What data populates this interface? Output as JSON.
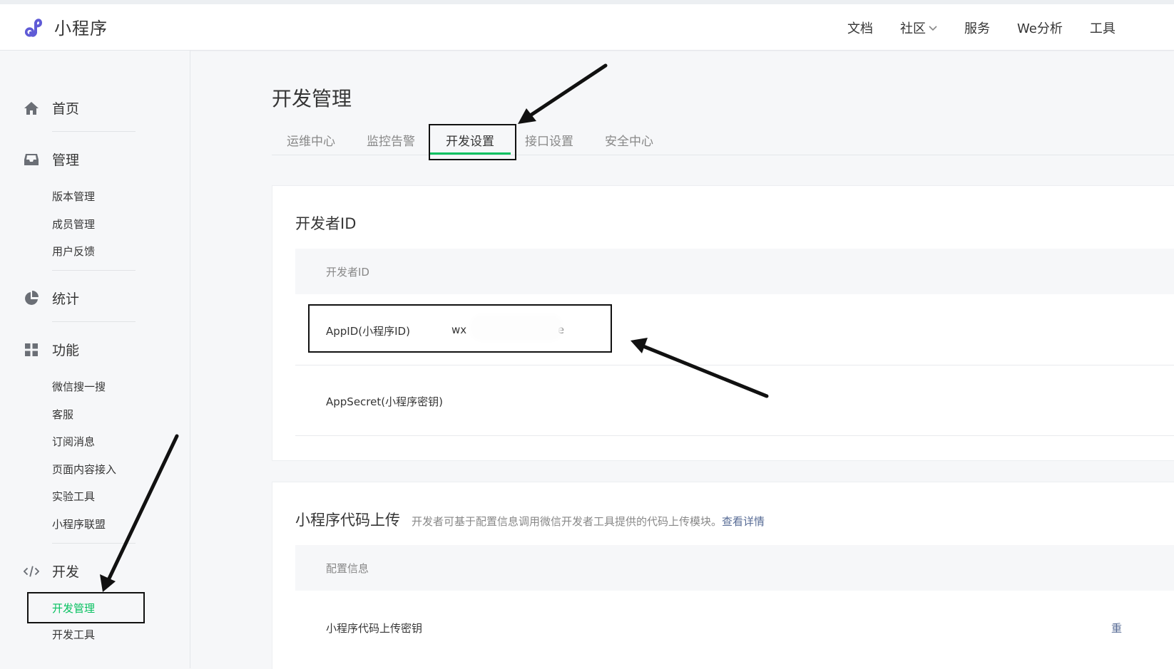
{
  "header": {
    "brand": "小程序",
    "nav": [
      {
        "label": "文档"
      },
      {
        "label": "社区",
        "chevron": true
      },
      {
        "label": "服务"
      },
      {
        "label": "We分析"
      },
      {
        "label": "工具"
      }
    ]
  },
  "sidebar": {
    "groups": [
      {
        "label": "首页",
        "icon": "home-icon"
      },
      {
        "label": "管理",
        "icon": "inbox-icon",
        "items": [
          "版本管理",
          "成员管理",
          "用户反馈"
        ]
      },
      {
        "label": "统计",
        "icon": "pie-chart-icon"
      },
      {
        "label": "功能",
        "icon": "grid-icon",
        "items": [
          "微信搜一搜",
          "客服",
          "订阅消息",
          "页面内容接入",
          "实验工具",
          "小程序联盟"
        ]
      },
      {
        "label": "开发",
        "icon": "code-icon",
        "items": [
          "开发管理",
          "开发工具"
        ]
      }
    ],
    "active_item": "开发管理"
  },
  "main": {
    "title": "开发管理",
    "tabs": [
      "运维中心",
      "监控告警",
      "开发设置",
      "接口设置",
      "安全中心"
    ],
    "active_tab": "开发设置",
    "developer_id": {
      "title": "开发者ID",
      "table_header": "开发者ID",
      "rows": [
        {
          "label": "AppID(小程序ID)",
          "value_start": "wx",
          "value_end": "7e"
        },
        {
          "label": "AppSecret(小程序密钥)"
        }
      ]
    },
    "code_upload": {
      "title": "小程序代码上传",
      "desc": "开发者可基于配置信息调用微信开发者工具提供的代码上传模块。",
      "link": "查看详情",
      "table_header": "配置信息",
      "rows": [
        {
          "label": "小程序代码上传密钥",
          "action": "重"
        }
      ]
    }
  },
  "colors": {
    "accent": "#07c160",
    "link": "#576b95",
    "brand_logo": "#5f5bd6"
  }
}
